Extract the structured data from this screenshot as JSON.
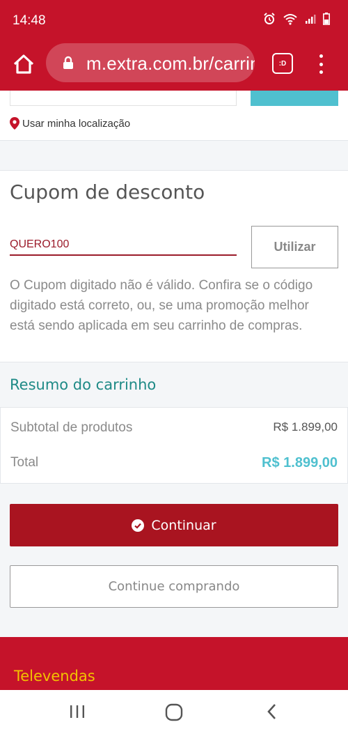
{
  "status_bar": {
    "time": "14:48",
    "icons": [
      "alarm-icon",
      "wifi-icon",
      "signal-icon",
      "battery-icon"
    ]
  },
  "browser": {
    "url": "m.extra.com.br/carrinho",
    "tab_label": ":D",
    "icons": [
      "home-icon",
      "lock-icon",
      "tab-switcher-icon",
      "more-vert-icon"
    ]
  },
  "location": {
    "label": "Usar minha localização",
    "icon": "map-pin-icon"
  },
  "coupon": {
    "title": "Cupom de desconto",
    "value": "QUERO100",
    "apply_label": "Utilizar",
    "error": "O Cupom digitado não é válido. Confira se o código digitado está correto, ou, se uma promoção melhor está sendo aplicada em seu carrinho de compras."
  },
  "summary": {
    "title": "Resumo do carrinho",
    "subtotal_label": "Subtotal de produtos",
    "subtotal_value": "R$ 1.899,00",
    "total_label": "Total",
    "total_value": "R$ 1.899,00"
  },
  "actions": {
    "continue_label": "Continuar",
    "continue_icon": "check-circle-icon",
    "keep_shopping_label": "Continue comprando"
  },
  "footer": {
    "televendas_label": "Televendas"
  },
  "nav": {
    "icons": [
      "recent-apps-icon",
      "home-nav-icon",
      "back-icon"
    ]
  },
  "colors": {
    "brand_red": "#c5132a",
    "button_red": "#a91420",
    "teal": "#1e8a86",
    "accent_blue": "#4fc0cf",
    "error_red": "#9b1b2a",
    "footer_yellow": "#f2c200"
  }
}
